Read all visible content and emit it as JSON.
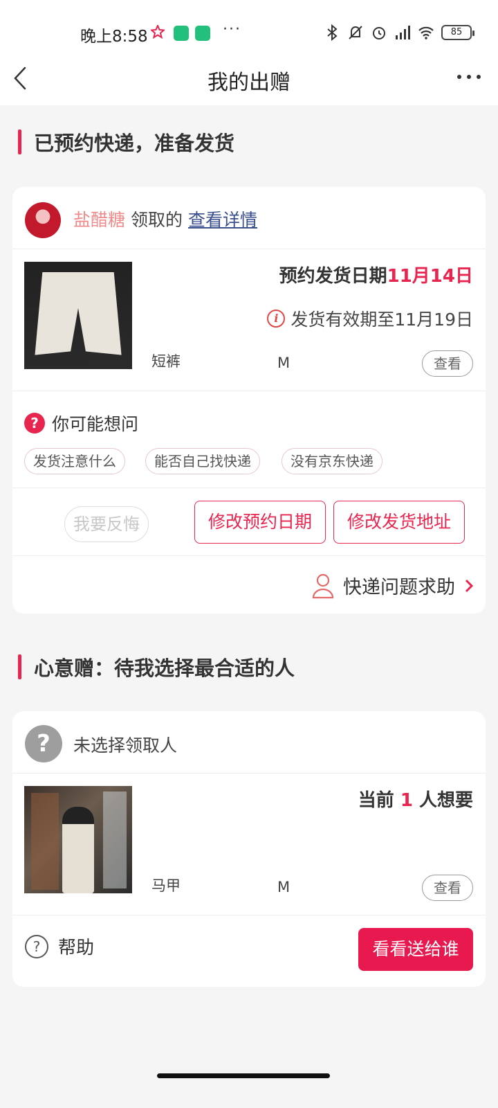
{
  "status_bar": {
    "time": "晚上8:58",
    "dots": "···",
    "battery": "85"
  },
  "nav": {
    "title": "我的出赠"
  },
  "section1": {
    "title": "已预约快递，准备发货",
    "card": {
      "user_name": "盐醋糖",
      "user_verb": "领取的",
      "detail_link": "查看详情",
      "product": {
        "name": "短裤",
        "size": "M",
        "view_label": "查看"
      },
      "ship_date_label": "预约发货日期",
      "ship_date_value": "11月14日",
      "ship_valid": "发货有效期至11月19日",
      "faq_title": "你可能想问",
      "faq_chips": [
        "发货注意什么",
        "能否自己找快递",
        "没有京东快递"
      ],
      "btn_regret": "我要反悔",
      "btn_change_date": "修改预约日期",
      "btn_change_address": "修改发货地址",
      "express_help": "快递问题求助"
    }
  },
  "section2": {
    "title": "心意赠：待我选择最合适的人",
    "card": {
      "no_receiver": "未选择领取人",
      "want_prefix": "当前",
      "want_count": "1",
      "want_suffix": "人想要",
      "product": {
        "name": "马甲",
        "size": "M",
        "view_label": "查看"
      },
      "help_label": "帮助",
      "btn_primary": "看看送给谁"
    }
  },
  "colors": {
    "accent": "#e8254f",
    "link": "#3a4f8f",
    "username": "#f08a8a"
  }
}
